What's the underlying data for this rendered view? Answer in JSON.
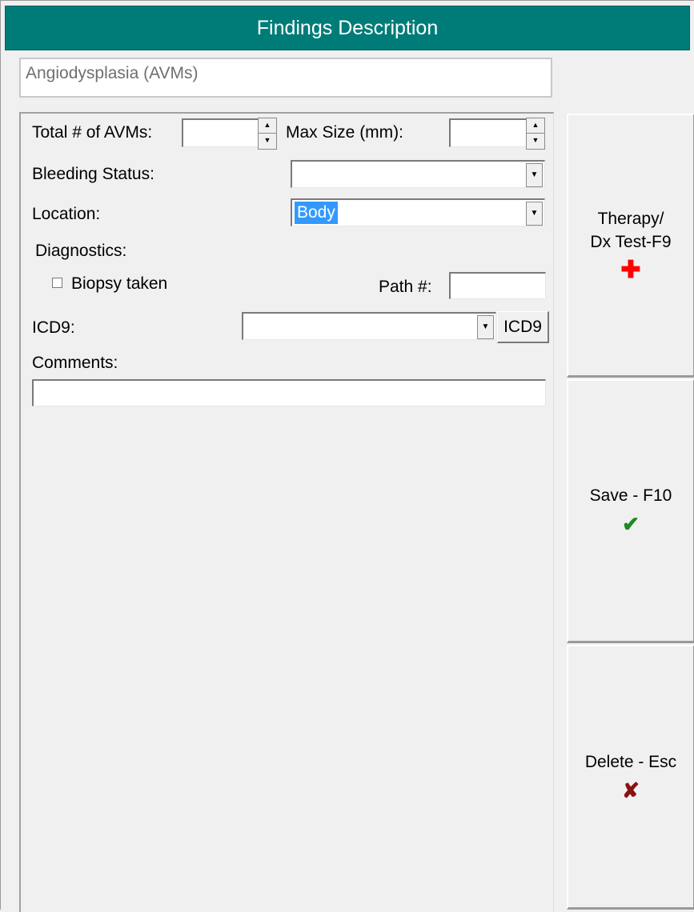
{
  "window": {
    "title": "Findings Description"
  },
  "finding": {
    "name": "Angiodysplasia (AVMs)"
  },
  "form": {
    "total_avms_label": "Total # of AVMs:",
    "total_avms_value": "",
    "max_size_label": "Max Size (mm):",
    "max_size_value": "",
    "bleeding_status_label": "Bleeding Status:",
    "bleeding_status_value": "",
    "location_label": "Location:",
    "location_value": "Body",
    "diagnostics_label": "Diagnostics:",
    "biopsy_label": "Biopsy taken",
    "biopsy_checked": false,
    "path_label": "Path #:",
    "path_value": "",
    "icd9_label": "ICD9:",
    "icd9_value": "",
    "icd9_button": "ICD9",
    "comments_label": "Comments:",
    "comments_value": ""
  },
  "sidebar": {
    "therapy": {
      "line1": "Therapy/",
      "line2": "Dx Test-F9",
      "icon": "plus-icon",
      "icon_color": "#ff0000"
    },
    "save": {
      "label": "Save - F10",
      "icon": "checkmark-icon",
      "icon_color": "#1e8a1e"
    },
    "delete": {
      "label": "Delete - Esc",
      "icon": "x-icon",
      "icon_color": "#8b1010"
    }
  },
  "colors": {
    "title_bar": "#007c78",
    "selection": "#3399ff"
  }
}
